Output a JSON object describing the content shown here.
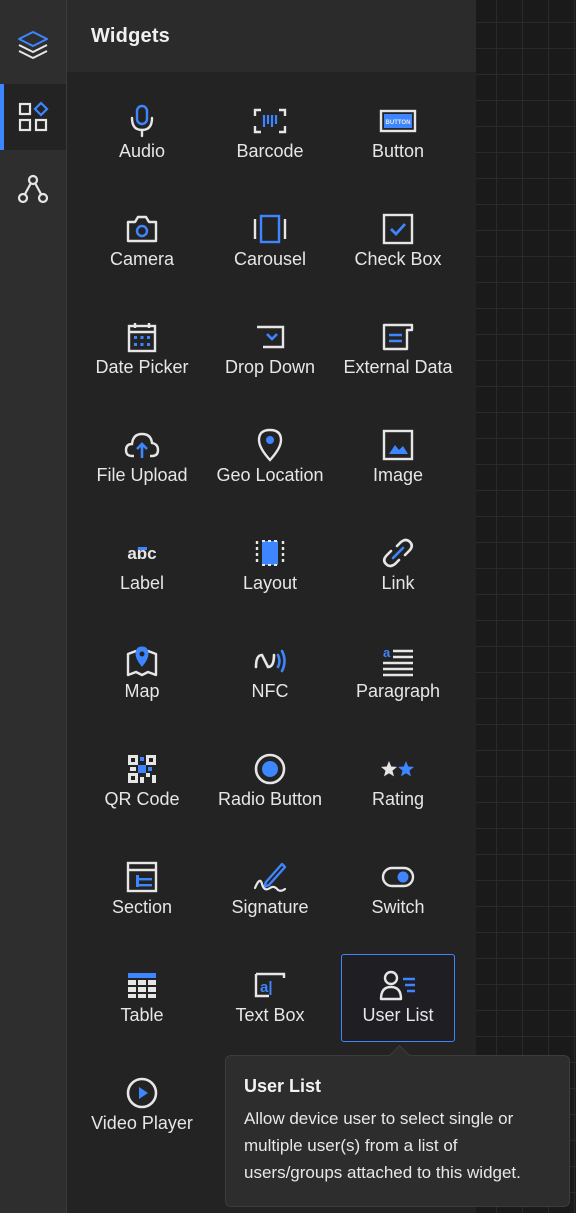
{
  "rail": {
    "items": [
      {
        "name": "layers-icon"
      },
      {
        "name": "widgets-icon",
        "active": true
      },
      {
        "name": "workflow-icon"
      }
    ]
  },
  "panel": {
    "title": "Widgets",
    "widgets": [
      {
        "label": "Audio",
        "icon": "microphone-icon"
      },
      {
        "label": "Barcode",
        "icon": "barcode-icon"
      },
      {
        "label": "Button",
        "icon": "button-icon"
      },
      {
        "label": "Camera",
        "icon": "camera-icon"
      },
      {
        "label": "Carousel",
        "icon": "carousel-icon"
      },
      {
        "label": "Check Box",
        "icon": "checkbox-icon"
      },
      {
        "label": "Date Picker",
        "icon": "calendar-icon"
      },
      {
        "label": "Drop Down",
        "icon": "dropdown-icon"
      },
      {
        "label": "External Data",
        "icon": "external-data-icon"
      },
      {
        "label": "File Upload",
        "icon": "cloud-upload-icon"
      },
      {
        "label": "Geo Location",
        "icon": "location-pin-icon"
      },
      {
        "label": "Image",
        "icon": "image-icon"
      },
      {
        "label": "Label",
        "icon": "label-icon"
      },
      {
        "label": "Layout",
        "icon": "layout-icon"
      },
      {
        "label": "Link",
        "icon": "link-icon"
      },
      {
        "label": "Map",
        "icon": "map-icon"
      },
      {
        "label": "NFC",
        "icon": "nfc-icon"
      },
      {
        "label": "Paragraph",
        "icon": "paragraph-icon"
      },
      {
        "label": "QR Code",
        "icon": "qr-code-icon"
      },
      {
        "label": "Radio Button",
        "icon": "radio-button-icon"
      },
      {
        "label": "Rating",
        "icon": "star-rating-icon"
      },
      {
        "label": "Section",
        "icon": "section-icon"
      },
      {
        "label": "Signature",
        "icon": "signature-icon"
      },
      {
        "label": "Switch",
        "icon": "toggle-switch-icon"
      },
      {
        "label": "Table",
        "icon": "table-icon"
      },
      {
        "label": "Text Box",
        "icon": "text-box-icon"
      },
      {
        "label": "User List",
        "icon": "user-list-icon",
        "selected": true
      },
      {
        "label": "Video Player",
        "icon": "play-circle-icon"
      }
    ]
  },
  "tooltip": {
    "title": "User List",
    "text": "Allow device user to select single or multiple user(s) from a list of users/groups attached to this widget."
  },
  "colors": {
    "accent": "#3d86ff",
    "icon": "#e6e6e6",
    "panel_bg": "#232323",
    "rail_bg": "#2e2e2e"
  },
  "text_button_icon": "BUTTON",
  "text_label_icon": "abc",
  "text_textbox_icon": "a|"
}
